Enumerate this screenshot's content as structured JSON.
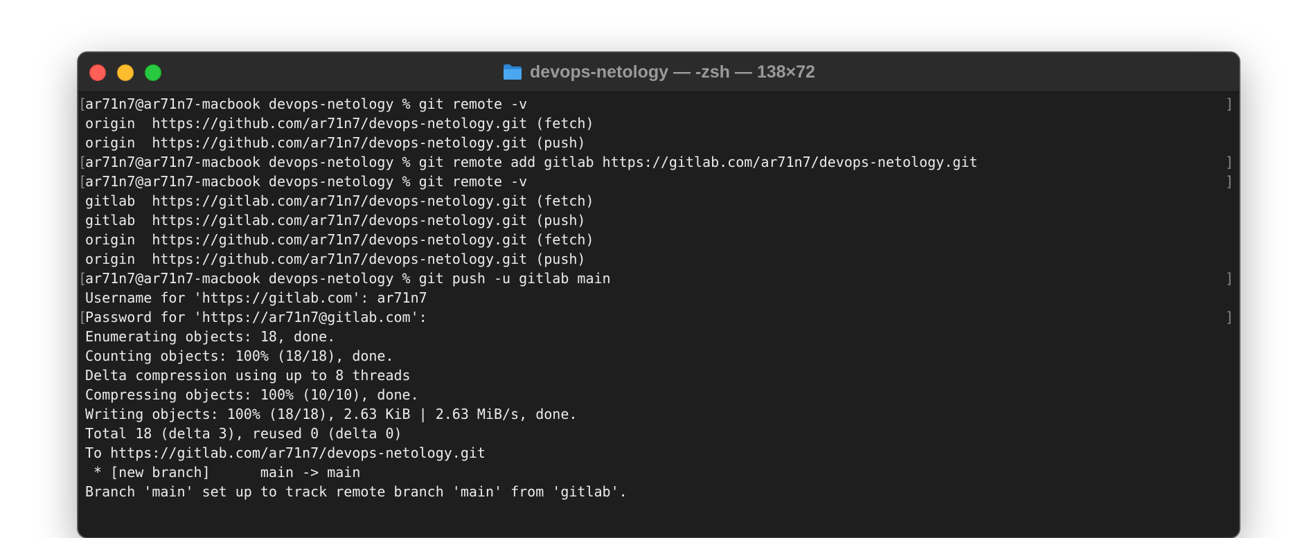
{
  "window": {
    "title": "devops-netology — -zsh — 138×72",
    "title_icon": "folder-icon",
    "traffic_lights": [
      "close",
      "minimize",
      "zoom"
    ],
    "colors": {
      "background": "#1e1e1e",
      "titlebar": "#2b2b2b",
      "text": "#ececec",
      "close": "#ff5f57",
      "minimize": "#febc2e",
      "zoom": "#28c840",
      "folder": "#3d9be9"
    }
  },
  "terminal": {
    "lines": [
      {
        "text": "ar71n7@ar71n7-macbook devops-netology % git remote -v",
        "prompt": true
      },
      {
        "text": "origin  https://github.com/ar71n7/devops-netology.git (fetch)",
        "prompt": false
      },
      {
        "text": "origin  https://github.com/ar71n7/devops-netology.git (push)",
        "prompt": false
      },
      {
        "text": "ar71n7@ar71n7-macbook devops-netology % git remote add gitlab https://gitlab.com/ar71n7/devops-netology.git",
        "prompt": true
      },
      {
        "text": "ar71n7@ar71n7-macbook devops-netology % git remote -v",
        "prompt": true
      },
      {
        "text": "gitlab  https://gitlab.com/ar71n7/devops-netology.git (fetch)",
        "prompt": false
      },
      {
        "text": "gitlab  https://gitlab.com/ar71n7/devops-netology.git (push)",
        "prompt": false
      },
      {
        "text": "origin  https://github.com/ar71n7/devops-netology.git (fetch)",
        "prompt": false
      },
      {
        "text": "origin  https://github.com/ar71n7/devops-netology.git (push)",
        "prompt": false
      },
      {
        "text": "ar71n7@ar71n7-macbook devops-netology % git push -u gitlab main",
        "prompt": true
      },
      {
        "text": "Username for 'https://gitlab.com': ar71n7",
        "prompt": false
      },
      {
        "text": "Password for 'https://ar71n7@gitlab.com':",
        "prompt": true
      },
      {
        "text": "Enumerating objects: 18, done.",
        "prompt": false
      },
      {
        "text": "Counting objects: 100% (18/18), done.",
        "prompt": false
      },
      {
        "text": "Delta compression using up to 8 threads",
        "prompt": false
      },
      {
        "text": "Compressing objects: 100% (10/10), done.",
        "prompt": false
      },
      {
        "text": "Writing objects: 100% (18/18), 2.63 KiB | 2.63 MiB/s, done.",
        "prompt": false
      },
      {
        "text": "Total 18 (delta 3), reused 0 (delta 0)",
        "prompt": false
      },
      {
        "text": "To https://gitlab.com/ar71n7/devops-netology.git",
        "prompt": false
      },
      {
        "text": " * [new branch]      main -> main",
        "prompt": false
      },
      {
        "text": "Branch 'main' set up to track remote branch 'main' from 'gitlab'.",
        "prompt": false
      }
    ]
  }
}
